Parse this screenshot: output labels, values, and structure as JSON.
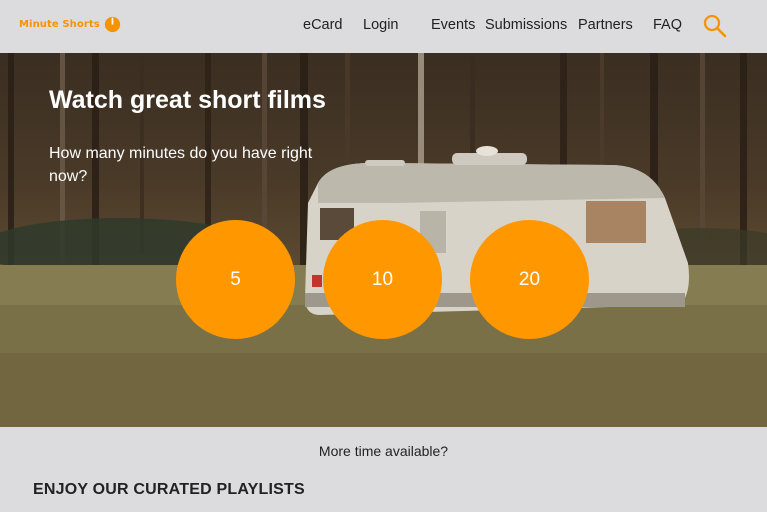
{
  "header": {
    "logo_text": "Minute Shorts",
    "nav": [
      {
        "label": "eCard"
      },
      {
        "label": "Login"
      },
      {
        "label": "Events"
      },
      {
        "label": "Submissions"
      },
      {
        "label": "Partners"
      },
      {
        "label": "FAQ"
      }
    ],
    "search_icon": "search-icon"
  },
  "hero": {
    "title": "Watch great short films",
    "subtitle": "How many minutes do you have right now?",
    "options": [
      {
        "label": "5"
      },
      {
        "label": "10"
      },
      {
        "label": "20"
      }
    ]
  },
  "more_time": "More time available?",
  "playlists_title": "ENJOY OUR CURATED PLAYLISTS",
  "colors": {
    "accent": "#ff9800",
    "logo": "#f59400",
    "header_bg": "#dcdcdf"
  }
}
